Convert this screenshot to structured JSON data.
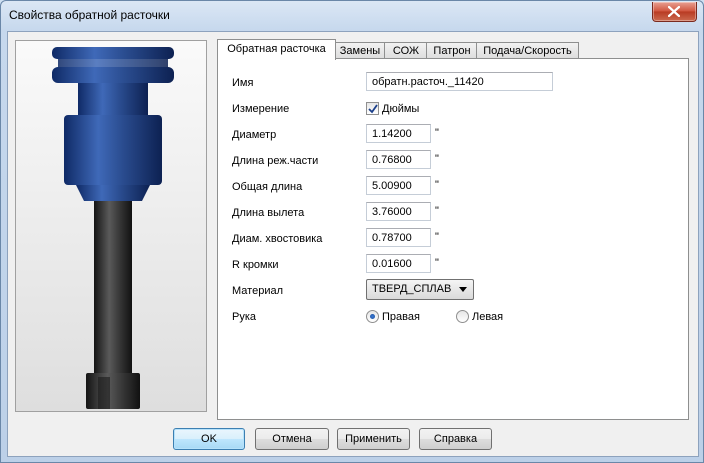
{
  "window": {
    "title": "Свойства обратной расточки"
  },
  "tabs": [
    "Обратная расточка",
    "Замены",
    "СОЖ",
    "Патрон",
    "Подача/Скорость"
  ],
  "form": {
    "name_label": "Имя",
    "name_value": "обратн.расточ._11420",
    "measure_label": "Измерение",
    "inches_label": "Дюймы",
    "inches_checked": true,
    "unit": "\"",
    "rows": [
      {
        "label": "Диаметр",
        "value": "1.14200"
      },
      {
        "label": "Длина реж.части",
        "value": "0.76800"
      },
      {
        "label": "Общая длина",
        "value": "5.00900"
      },
      {
        "label": "Длина вылета",
        "value": "3.76000"
      },
      {
        "label": "Диам. хвостовика",
        "value": "0.78700"
      },
      {
        "label": "R кромки",
        "value": "0.01600"
      }
    ],
    "material_label": "Материал",
    "material_value": "ТВЕРД_СПЛАВ",
    "hand_label": "Рука",
    "hand_right": "Правая",
    "hand_left": "Левая",
    "hand_selected": "right"
  },
  "buttons": {
    "ok": "OK",
    "cancel": "Отмена",
    "apply": "Применить",
    "help": "Справка"
  },
  "colors": {
    "tool_holder": "#2a4c8f",
    "tool_shank": "#3a3a3a"
  }
}
